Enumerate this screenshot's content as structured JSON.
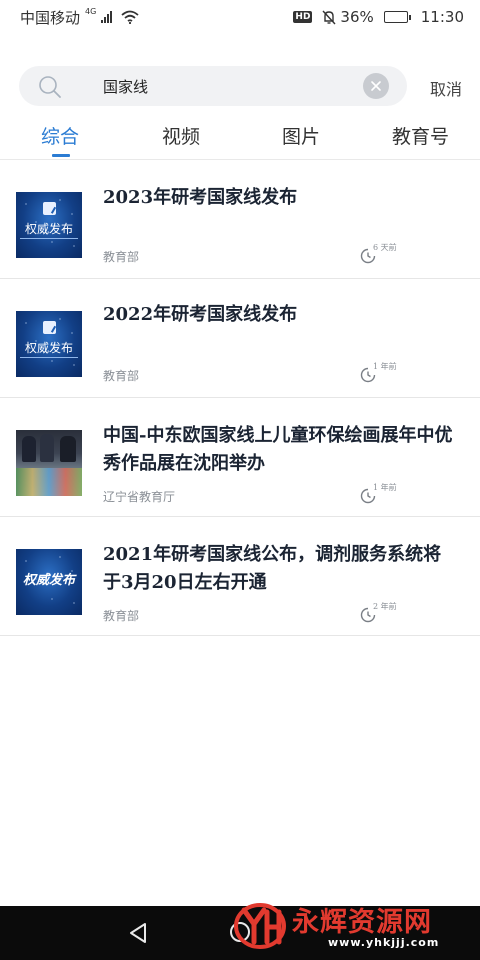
{
  "status_bar": {
    "carrier": "中国移动",
    "network": "4G",
    "hd": "HD",
    "battery": "36%",
    "battery_level": 0.36,
    "time": "11:30"
  },
  "search": {
    "query": "国家线",
    "cancel_label": "取消"
  },
  "tabs": [
    {
      "label": "综合",
      "active": true
    },
    {
      "label": "视频",
      "active": false
    },
    {
      "label": "图片",
      "active": false
    },
    {
      "label": "教育号",
      "active": false
    }
  ],
  "news": [
    {
      "title": "2023年研考国家线发布",
      "source": "教育部",
      "time": "6 天前",
      "thumb_text": "权威发布",
      "thumb_type": "blue"
    },
    {
      "title": "2022年研考国家线发布",
      "source": "教育部",
      "time": "1 年前",
      "thumb_text": "权威发布",
      "thumb_type": "blue"
    },
    {
      "title": "中国-中东欧国家线上儿童环保绘画展年中优秀作品展在沈阳举办",
      "source": "辽宁省教育厅",
      "time": "1 年前",
      "thumb_type": "photo"
    },
    {
      "title": "2021年研考国家线公布，调剂服务系统将于3月20日左右开通",
      "source": "教育部",
      "time": "2 年前",
      "thumb_text": "权威发布",
      "thumb_type": "blue-bold"
    }
  ],
  "watermark": {
    "name": "永辉资源网",
    "url": "www.yhkjjj.com"
  },
  "colors": {
    "accent": "#2b7cd3",
    "watermark_red": "#e23a2f"
  }
}
